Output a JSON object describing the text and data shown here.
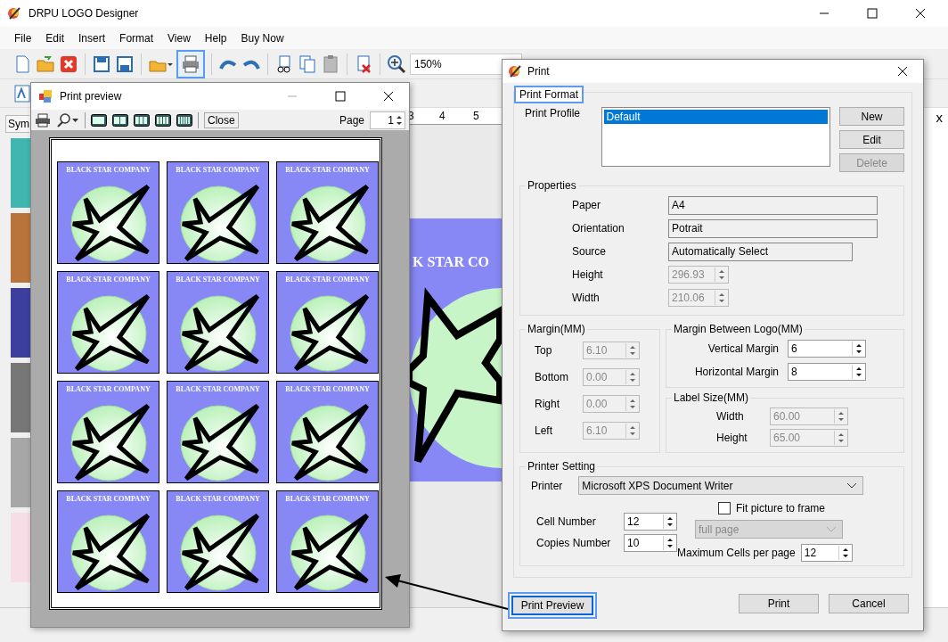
{
  "app": {
    "title": "DRPU LOGO Designer",
    "menu": [
      "File",
      "Edit",
      "Insert",
      "Format",
      "View",
      "Help",
      "Buy Now"
    ],
    "print_tool": {
      "highlighted": true
    },
    "zoom": "150%",
    "side_tab": "Sym",
    "ruler": [
      "3",
      "4",
      "5"
    ],
    "canvas_text": "K STAR CO",
    "panel_close": "x"
  },
  "preview": {
    "title": "Print preview",
    "close": "Close",
    "page_label": "Page",
    "page": "1",
    "logos": [
      {
        "text": "BLACK STAR COMPANY"
      },
      {
        "text": "BLACK STAR COMPANY"
      },
      {
        "text": "BLACK STAR COMPANY"
      },
      {
        "text": "BLACK STAR COMPANY"
      },
      {
        "text": "BLACK STAR COMPANY"
      },
      {
        "text": "BLACK STAR COMPANY"
      },
      {
        "text": "BLACK STAR COMPANY"
      },
      {
        "text": "BLACK STAR COMPANY"
      },
      {
        "text": "BLACK STAR COMPANY"
      },
      {
        "text": "BLACK STAR COMPANY"
      },
      {
        "text": "BLACK STAR COMPANY"
      },
      {
        "text": "BLACK STAR COMPANY"
      }
    ]
  },
  "dialog": {
    "title": "Print",
    "tab": {
      "label": "Print Format",
      "highlighted": true
    },
    "profile_label": "Print Profile",
    "profiles": [
      {
        "name": "Default",
        "selected": true
      }
    ],
    "profile_buttons": [
      {
        "label": "New",
        "disabled": false
      },
      {
        "label": "Edit",
        "disabled": false
      },
      {
        "label": "Delete",
        "disabled": true
      }
    ],
    "properties": {
      "title": "Properties",
      "fields": [
        {
          "label": "Paper",
          "value": "A4",
          "kind": "text"
        },
        {
          "label": "Orientation",
          "value": "Potrait",
          "kind": "text"
        },
        {
          "label": "Source",
          "value": "Automatically Select",
          "kind": "text"
        },
        {
          "label": "Height",
          "value": "296.93",
          "kind": "spin",
          "disabled": true
        },
        {
          "label": "Width",
          "value": "210.06",
          "kind": "spin",
          "disabled": true
        }
      ]
    },
    "margin": {
      "title": "Margin(MM)",
      "fields": [
        {
          "label": "Top",
          "value": "6.10",
          "disabled": true
        },
        {
          "label": "Bottom",
          "value": "0.00",
          "disabled": true
        },
        {
          "label": "Right",
          "value": "0.00",
          "disabled": true
        },
        {
          "label": "Left",
          "value": "6.10",
          "disabled": true
        }
      ]
    },
    "logo_margin": {
      "title": "Margin Between Logo(MM)",
      "fields": [
        {
          "label": "Vertical Margin",
          "value": "6",
          "disabled": false
        },
        {
          "label": "Horizontal Margin",
          "value": "8",
          "disabled": false
        }
      ]
    },
    "label_size": {
      "title": "Label Size(MM)",
      "fields": [
        {
          "label": "Width",
          "value": "60.00",
          "disabled": true
        },
        {
          "label": "Height",
          "value": "65.00",
          "disabled": true
        }
      ]
    },
    "printer": {
      "title": "Printer Setting",
      "printer_label": "Printer",
      "printer": "Microsoft XPS Document Writer",
      "cell": {
        "label": "Cell Number",
        "value": "12",
        "disabled": false
      },
      "copies": {
        "label": "Copies Number",
        "value": "10",
        "disabled": false
      },
      "fit": {
        "label": "Fit picture to frame",
        "checked": false
      },
      "fit_mode": {
        "value": "full page",
        "disabled": true
      },
      "max_cells": {
        "label": "Maximum Cells per page",
        "value": "12",
        "disabled": false
      }
    },
    "footer": [
      {
        "label": "Print Preview",
        "highlighted": true
      },
      {
        "label": "Print",
        "highlighted": false
      },
      {
        "label": "Cancel",
        "highlighted": false
      }
    ]
  }
}
